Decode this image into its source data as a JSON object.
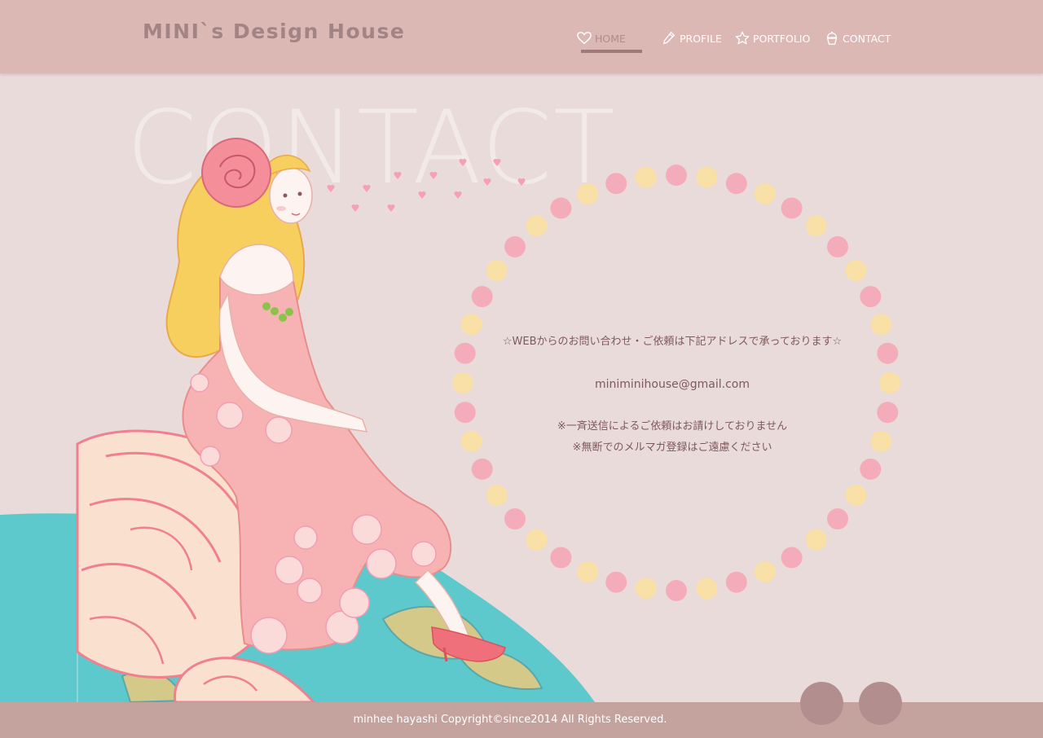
{
  "header": {
    "logo": "MINI`s Design House",
    "nav": [
      {
        "label": "HOME",
        "icon": "heart-icon",
        "active": true
      },
      {
        "label": "PROFILE",
        "icon": "pencil-icon",
        "active": false
      },
      {
        "label": "PORTFOLIO",
        "icon": "star-icon",
        "active": false
      },
      {
        "label": "CONTACT",
        "icon": "cupcake-icon",
        "active": false
      }
    ]
  },
  "main": {
    "watermark": "CONTACT",
    "lead": "☆WEBからのお問い合わせ・ご依頼は下記アドレスで承っております☆",
    "email": "miniminihouse@gmail.com",
    "note1": "※一斉送信によるご依頼はお請けしておりません",
    "note2": "※無断でのメルマガ登録はご遠慮ください"
  },
  "footer": {
    "copyright": "minhee hayashi Copyright©since2014 All Rights Reserved."
  },
  "colors": {
    "header_bg": "#dcb8b5",
    "page_bg": "#eadbdb",
    "footer_bg": "#c4a29e",
    "text": "#7d5a5a",
    "dot_pink": "#f6a6b6",
    "dot_yellow": "#fbe0a0",
    "teal": "#5ec9cc"
  }
}
